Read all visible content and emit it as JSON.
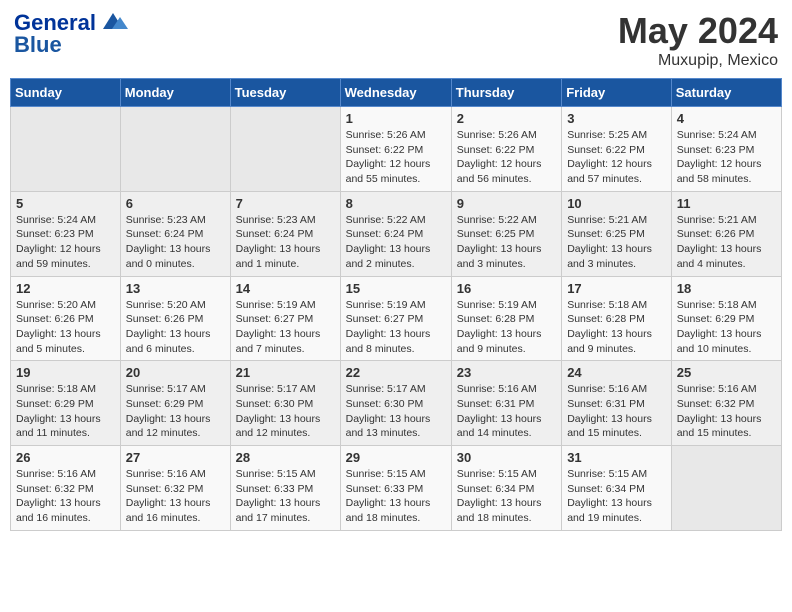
{
  "header": {
    "logo_general": "General",
    "logo_blue": "Blue",
    "title": "May 2024",
    "subtitle": "Muxupip, Mexico"
  },
  "weekdays": [
    "Sunday",
    "Monday",
    "Tuesday",
    "Wednesday",
    "Thursday",
    "Friday",
    "Saturday"
  ],
  "weeks": [
    [
      {
        "day": "",
        "info": ""
      },
      {
        "day": "",
        "info": ""
      },
      {
        "day": "",
        "info": ""
      },
      {
        "day": "1",
        "info": "Sunrise: 5:26 AM\nSunset: 6:22 PM\nDaylight: 12 hours\nand 55 minutes."
      },
      {
        "day": "2",
        "info": "Sunrise: 5:26 AM\nSunset: 6:22 PM\nDaylight: 12 hours\nand 56 minutes."
      },
      {
        "day": "3",
        "info": "Sunrise: 5:25 AM\nSunset: 6:22 PM\nDaylight: 12 hours\nand 57 minutes."
      },
      {
        "day": "4",
        "info": "Sunrise: 5:24 AM\nSunset: 6:23 PM\nDaylight: 12 hours\nand 58 minutes."
      }
    ],
    [
      {
        "day": "5",
        "info": "Sunrise: 5:24 AM\nSunset: 6:23 PM\nDaylight: 12 hours\nand 59 minutes."
      },
      {
        "day": "6",
        "info": "Sunrise: 5:23 AM\nSunset: 6:24 PM\nDaylight: 13 hours\nand 0 minutes."
      },
      {
        "day": "7",
        "info": "Sunrise: 5:23 AM\nSunset: 6:24 PM\nDaylight: 13 hours\nand 1 minute."
      },
      {
        "day": "8",
        "info": "Sunrise: 5:22 AM\nSunset: 6:24 PM\nDaylight: 13 hours\nand 2 minutes."
      },
      {
        "day": "9",
        "info": "Sunrise: 5:22 AM\nSunset: 6:25 PM\nDaylight: 13 hours\nand 3 minutes."
      },
      {
        "day": "10",
        "info": "Sunrise: 5:21 AM\nSunset: 6:25 PM\nDaylight: 13 hours\nand 3 minutes."
      },
      {
        "day": "11",
        "info": "Sunrise: 5:21 AM\nSunset: 6:26 PM\nDaylight: 13 hours\nand 4 minutes."
      }
    ],
    [
      {
        "day": "12",
        "info": "Sunrise: 5:20 AM\nSunset: 6:26 PM\nDaylight: 13 hours\nand 5 minutes."
      },
      {
        "day": "13",
        "info": "Sunrise: 5:20 AM\nSunset: 6:26 PM\nDaylight: 13 hours\nand 6 minutes."
      },
      {
        "day": "14",
        "info": "Sunrise: 5:19 AM\nSunset: 6:27 PM\nDaylight: 13 hours\nand 7 minutes."
      },
      {
        "day": "15",
        "info": "Sunrise: 5:19 AM\nSunset: 6:27 PM\nDaylight: 13 hours\nand 8 minutes."
      },
      {
        "day": "16",
        "info": "Sunrise: 5:19 AM\nSunset: 6:28 PM\nDaylight: 13 hours\nand 9 minutes."
      },
      {
        "day": "17",
        "info": "Sunrise: 5:18 AM\nSunset: 6:28 PM\nDaylight: 13 hours\nand 9 minutes."
      },
      {
        "day": "18",
        "info": "Sunrise: 5:18 AM\nSunset: 6:29 PM\nDaylight: 13 hours\nand 10 minutes."
      }
    ],
    [
      {
        "day": "19",
        "info": "Sunrise: 5:18 AM\nSunset: 6:29 PM\nDaylight: 13 hours\nand 11 minutes."
      },
      {
        "day": "20",
        "info": "Sunrise: 5:17 AM\nSunset: 6:29 PM\nDaylight: 13 hours\nand 12 minutes."
      },
      {
        "day": "21",
        "info": "Sunrise: 5:17 AM\nSunset: 6:30 PM\nDaylight: 13 hours\nand 12 minutes."
      },
      {
        "day": "22",
        "info": "Sunrise: 5:17 AM\nSunset: 6:30 PM\nDaylight: 13 hours\nand 13 minutes."
      },
      {
        "day": "23",
        "info": "Sunrise: 5:16 AM\nSunset: 6:31 PM\nDaylight: 13 hours\nand 14 minutes."
      },
      {
        "day": "24",
        "info": "Sunrise: 5:16 AM\nSunset: 6:31 PM\nDaylight: 13 hours\nand 15 minutes."
      },
      {
        "day": "25",
        "info": "Sunrise: 5:16 AM\nSunset: 6:32 PM\nDaylight: 13 hours\nand 15 minutes."
      }
    ],
    [
      {
        "day": "26",
        "info": "Sunrise: 5:16 AM\nSunset: 6:32 PM\nDaylight: 13 hours\nand 16 minutes."
      },
      {
        "day": "27",
        "info": "Sunrise: 5:16 AM\nSunset: 6:32 PM\nDaylight: 13 hours\nand 16 minutes."
      },
      {
        "day": "28",
        "info": "Sunrise: 5:15 AM\nSunset: 6:33 PM\nDaylight: 13 hours\nand 17 minutes."
      },
      {
        "day": "29",
        "info": "Sunrise: 5:15 AM\nSunset: 6:33 PM\nDaylight: 13 hours\nand 18 minutes."
      },
      {
        "day": "30",
        "info": "Sunrise: 5:15 AM\nSunset: 6:34 PM\nDaylight: 13 hours\nand 18 minutes."
      },
      {
        "day": "31",
        "info": "Sunrise: 5:15 AM\nSunset: 6:34 PM\nDaylight: 13 hours\nand 19 minutes."
      },
      {
        "day": "",
        "info": ""
      }
    ]
  ]
}
